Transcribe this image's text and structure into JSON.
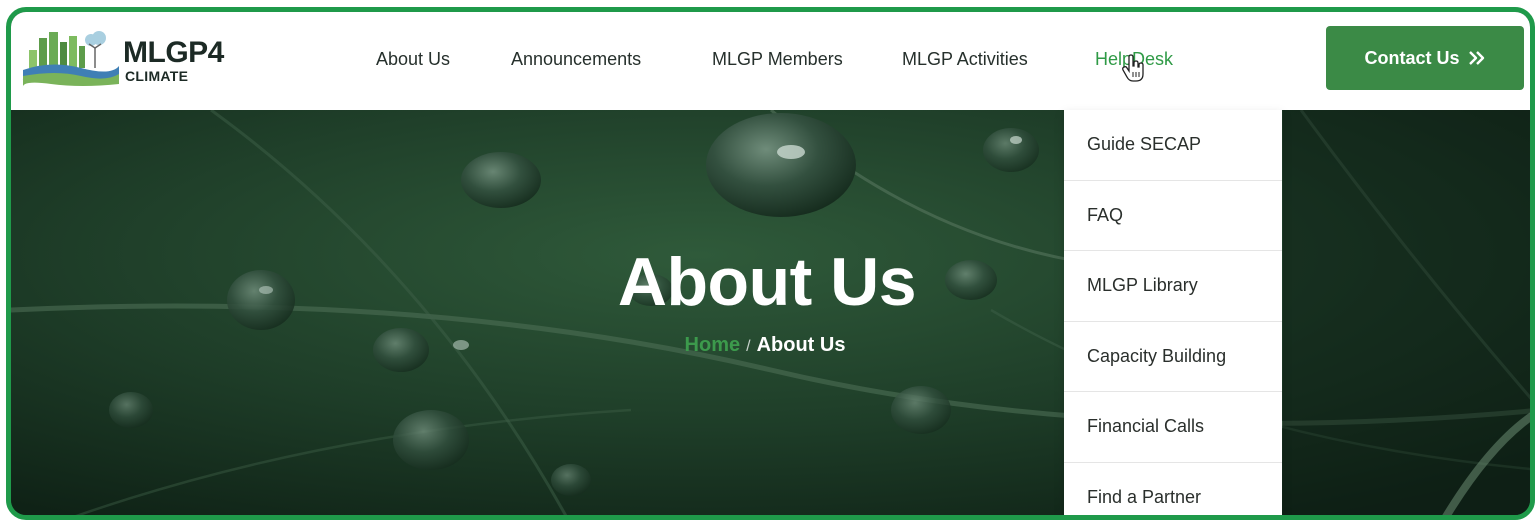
{
  "brand": {
    "name": "MLGP4",
    "subtitle": "CLIMATE"
  },
  "nav": {
    "items": [
      {
        "label": "About Us"
      },
      {
        "label": "Announcements"
      },
      {
        "label": "MLGP Members"
      },
      {
        "label": "MLGP Activities"
      },
      {
        "label": "HelpDesk",
        "active": true
      }
    ],
    "contact_label": "Contact Us",
    "contact_icon": "double-chevron-right-icon"
  },
  "hero": {
    "title": "About Us",
    "breadcrumb": {
      "home": "Home",
      "separator": "/",
      "current": "About Us"
    }
  },
  "helpdesk_menu": {
    "items": [
      {
        "label": "Guide SECAP"
      },
      {
        "label": "FAQ"
      },
      {
        "label": "MLGP Library"
      },
      {
        "label": "Capacity Building"
      },
      {
        "label": "Financial Calls"
      },
      {
        "label": "Find a Partner"
      }
    ]
  },
  "colors": {
    "accent_green": "#3b8a46",
    "frame_green": "#1f9a4a",
    "active_link": "#2f9a46"
  }
}
